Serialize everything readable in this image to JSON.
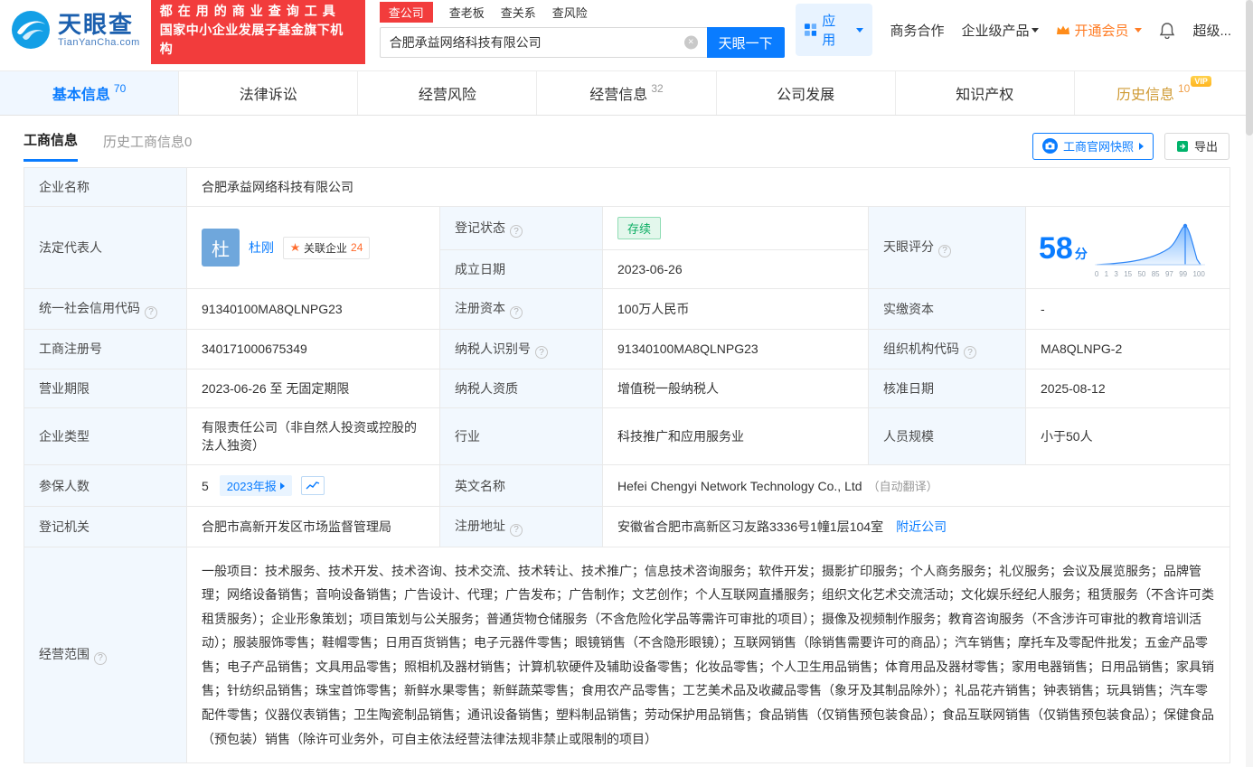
{
  "colors": {
    "brand_blue": "#0a7cff",
    "brand_red": "#f23c3c",
    "vip_orange": "#ff7d26",
    "status_green": "#0bae63",
    "history_tab_orange": "#cf9a34",
    "label_cell_bg": "#f2f8fe"
  },
  "icons": {
    "help": "?",
    "clear": "×",
    "camera": "camera",
    "export": "export-arrow",
    "bell": "bell",
    "apps_grid": "grid",
    "vip_crown": "crown",
    "trend": "line-chart",
    "related_star": "starburst"
  },
  "header": {
    "logo_title": "天眼查",
    "logo_sub": "TianYanCha.com",
    "slogan_line1": "都在用的商业查询工具",
    "slogan_line2": "国家中小企业发展子基金旗下机构",
    "search_tabs": [
      {
        "label": "查公司"
      },
      {
        "label": "查老板"
      },
      {
        "label": "查关系"
      },
      {
        "label": "查风险"
      }
    ],
    "search_value": "合肥承益网络科技有限公司",
    "search_button": "天眼一下",
    "nav_apps": "应用",
    "nav_items": [
      "商务合作",
      "企业级产品",
      "开通会员",
      "超级..."
    ]
  },
  "tabs": [
    {
      "label": "基本信息",
      "count": "70"
    },
    {
      "label": "法律诉讼",
      "count": ""
    },
    {
      "label": "经营风险",
      "count": ""
    },
    {
      "label": "经营信息",
      "count": "32"
    },
    {
      "label": "公司发展",
      "count": ""
    },
    {
      "label": "知识产权",
      "count": ""
    },
    {
      "label": "历史信息",
      "count": "10",
      "badge": "VIP"
    }
  ],
  "subnav": {
    "tab1": "工商信息",
    "tab2": "历史工商信息0",
    "snapshot_button": "工商官网快照",
    "export_button": "导出"
  },
  "info": {
    "company_name_label": "企业名称",
    "company_name": "合肥承益网络科技有限公司",
    "legal_rep_label": "法定代表人",
    "legal_rep_avatar": "杜",
    "legal_rep_name": "杜刚",
    "related_companies_label": "关联企业",
    "related_companies_count": "24",
    "reg_status_label": "登记状态",
    "reg_status": "存续",
    "establish_date_label": "成立日期",
    "establish_date": "2023-06-26",
    "score_label": "天眼评分",
    "score_value": "58",
    "score_unit": "分",
    "score_axis": [
      "0",
      "1",
      "3",
      "15",
      "50",
      "85",
      "97",
      "99",
      "100"
    ],
    "credit_code_label": "统一社会信用代码",
    "credit_code": "91340100MA8QLNPG23",
    "reg_capital_label": "注册资本",
    "reg_capital": "100万人民币",
    "paid_capital_label": "实缴资本",
    "paid_capital": "-",
    "reg_number_label": "工商注册号",
    "reg_number": "340171000675349",
    "taxpayer_id_label": "纳税人识别号",
    "taxpayer_id": "91340100MA8QLNPG23",
    "org_code_label": "组织机构代码",
    "org_code": "MA8QLNPG-2",
    "business_term_label": "营业期限",
    "business_term": "2023-06-26 至 无固定期限",
    "taxpayer_quality_label": "纳税人资质",
    "taxpayer_quality": "增值税一般纳税人",
    "approval_date_label": "核准日期",
    "approval_date": "2025-08-12",
    "company_type_label": "企业类型",
    "company_type": "有限责任公司（非自然人投资或控股的法人独资）",
    "industry_label": "行业",
    "industry": "科技推广和应用服务业",
    "staff_size_label": "人员规模",
    "staff_size": "小于50人",
    "insured_label": "参保人数",
    "insured_count": "5",
    "annual_report_button": "2023年报",
    "english_name_label": "英文名称",
    "english_name": "Hefei Chengyi Network Technology Co., Ltd",
    "english_name_note": "（自动翻译）",
    "reg_authority_label": "登记机关",
    "reg_authority": "合肥市高新开发区市场监督管理局",
    "reg_address_label": "注册地址",
    "reg_address": "安徽省合肥市高新区习友路3336号1幢1层104室",
    "nearby_link": "附近公司",
    "business_scope_label": "经营范围",
    "business_scope": "一般项目：技术服务、技术开发、技术咨询、技术交流、技术转让、技术推广；信息技术咨询服务；软件开发；摄影扩印服务；个人商务服务；礼仪服务；会议及展览服务；品牌管理；网络设备销售；音响设备销售；广告设计、代理；广告发布；广告制作；文艺创作；个人互联网直播服务；组织文化艺术交流活动；文化娱乐经纪人服务；租赁服务（不含许可类租赁服务）；企业形象策划；项目策划与公关服务；普通货物仓储服务（不含危险化学品等需许可审批的项目）；摄像及视频制作服务；教育咨询服务（不含涉许可审批的教育培训活动）；服装服饰零售；鞋帽零售；日用百货销售；电子元器件零售；眼镜销售（不含隐形眼镜）；互联网销售（除销售需要许可的商品）；汽车销售；摩托车及零配件批发；五金产品零售；电子产品销售；文具用品零售；照相机及器材销售；计算机软硬件及辅助设备零售；化妆品零售；个人卫生用品销售；体育用品及器材零售；家用电器销售；日用品销售；家具销售；针纺织品销售；珠宝首饰零售；新鲜水果零售；新鲜蔬菜零售；食用农产品零售；工艺美术品及收藏品零售（象牙及其制品除外）；礼品花卉销售；钟表销售；玩具销售；汽车零配件零售；仪器仪表销售；卫生陶瓷制品销售；通讯设备销售；塑料制品销售；劳动保护用品销售；食品销售（仅销售预包装食品）；食品互联网销售（仅销售预包装食品）；保健食品（预包装）销售（除许可业务外，可自主依法经营法律法规非禁止或限制的项目）"
  }
}
